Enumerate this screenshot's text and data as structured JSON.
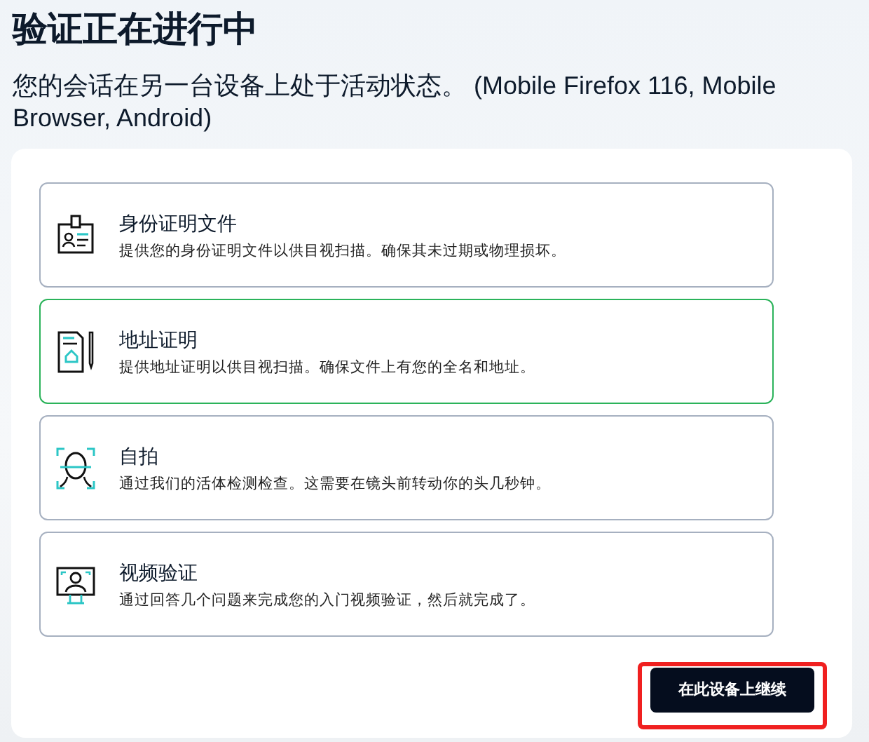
{
  "title": "验证正在进行中",
  "subtitle": "您的会话在另一台设备上处于活动状态。 (Mobile Firefox 116, Mobile Browser, Android)",
  "options": [
    {
      "kind": "id",
      "title": "身份证明文件",
      "description": "提供您的身份证明文件以供目视扫描。确保其未过期或物理损坏。",
      "selected": false
    },
    {
      "kind": "address",
      "title": "地址证明",
      "description": "提供地址证明以供目视扫描。确保文件上有您的全名和地址。",
      "selected": true
    },
    {
      "kind": "selfie",
      "title": "自拍",
      "description": "通过我们的活体检测检查。这需要在镜头前转动你的头几秒钟。",
      "selected": false
    },
    {
      "kind": "video",
      "title": "视频验证",
      "description": "通过回答几个问题来完成您的入门视频验证，然后就完成了。",
      "selected": false
    }
  ],
  "continue_button": {
    "label": "在此设备上继续",
    "highlighted": true
  }
}
